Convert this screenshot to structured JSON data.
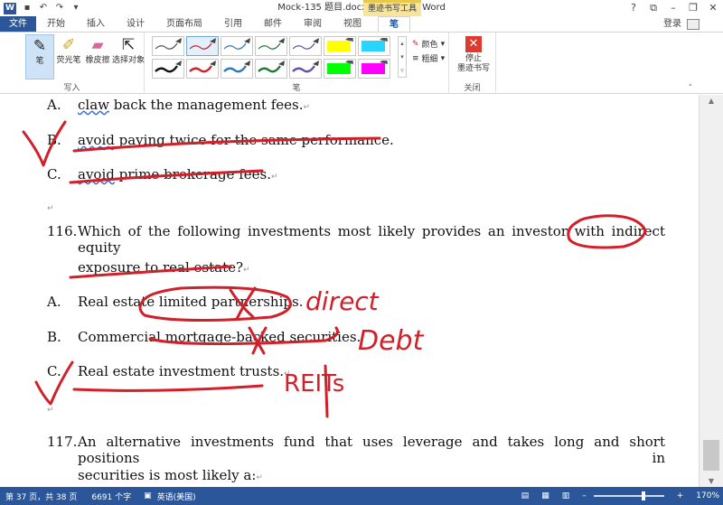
{
  "window": {
    "title": "Mock-135 题目.docx [兼容模式] - Word",
    "context_tab": "墨迹书写工具",
    "help": "?",
    "ribbon_toggle": "⧉",
    "minimize": "–",
    "restore": "❐",
    "close": "✕"
  },
  "tabs": [
    {
      "label": "文件"
    },
    {
      "label": "开始"
    },
    {
      "label": "插入"
    },
    {
      "label": "设计"
    },
    {
      "label": "页面布局"
    },
    {
      "label": "引用"
    },
    {
      "label": "邮件"
    },
    {
      "label": "审阅"
    },
    {
      "label": "视图"
    },
    {
      "label": "笔"
    }
  ],
  "account": {
    "login": "登录"
  },
  "ribbon": {
    "write_group": {
      "label": "写入",
      "tools": [
        {
          "label": "笔",
          "icon": "pen-icon"
        },
        {
          "label": "荧光笔",
          "icon": "highlighter-icon"
        },
        {
          "label": "橡皮擦",
          "icon": "eraser-icon"
        },
        {
          "label": "选择对象",
          "icon": "select-icon"
        }
      ]
    },
    "pens_group": {
      "label": "笔",
      "color_label": "颜色",
      "weight_label": "粗细",
      "pens": [
        {
          "color": "#555555",
          "style": "thin"
        },
        {
          "color": "#d0202a",
          "style": "thin"
        },
        {
          "color": "#2b79b8",
          "style": "thin"
        },
        {
          "color": "#1e7a36",
          "style": "thin"
        },
        {
          "color": "#6a4ea8",
          "style": "thin"
        },
        {
          "color": "#ffff00",
          "style": "highlight"
        },
        {
          "color": "#29d4ff",
          "style": "highlight"
        },
        {
          "color": "#111111",
          "style": "thick"
        },
        {
          "color": "#d0202a",
          "style": "thick"
        },
        {
          "color": "#2b79b8",
          "style": "thick"
        },
        {
          "color": "#1e7a36",
          "style": "thick"
        },
        {
          "color": "#6a4ea8",
          "style": "thick"
        },
        {
          "color": "#00ff00",
          "style": "highlight"
        },
        {
          "color": "#ff00ff",
          "style": "highlight"
        }
      ]
    },
    "close_group": {
      "label": "关闭",
      "stop_label_1": "停止",
      "stop_label_2": "墨迹书写"
    }
  },
  "document": {
    "lines": {
      "l1_label": "A.",
      "l1_text_a": "claw",
      "l1_text_b": " back the management fees.",
      "l2_label": "B.",
      "l2_text_a": "avoid",
      "l2_text_b": " paying twice for the same performance.",
      "l3_label": "C.",
      "l3_text_a": "avoid",
      "l3_text_b": " prime brokerage fees.",
      "q116_num": "116.",
      "q116_text": "Which of the following investments most likely provides an investor with indirect equity",
      "q116_text2": "exposure to real estate?",
      "a116_label": "A.",
      "a116_text": "Real estate limited partnerships.",
      "b116_label": "B.",
      "b116_text": "Commercial mortgage-backed securities.",
      "c116_label": "C.",
      "c116_text": "Real estate investment trusts.",
      "q117_num": "117.",
      "q117_text": "An alternative investments fund that uses leverage and takes long and short positions in",
      "q117_text2": "securities is most likely a:"
    },
    "para_mark": "↵",
    "annotations": {
      "a": "direct",
      "b": "Debt",
      "c": "REITs"
    }
  },
  "status": {
    "page": "第 37 页，共 38 页",
    "words": "6691 个字",
    "lang": "英语(美国)",
    "zoom": "170%",
    "zoom_fraction": 0.68
  },
  "colors": {
    "accent": "#2b579a",
    "ink": "#d0202a",
    "context_tab": "#f6e59a"
  }
}
